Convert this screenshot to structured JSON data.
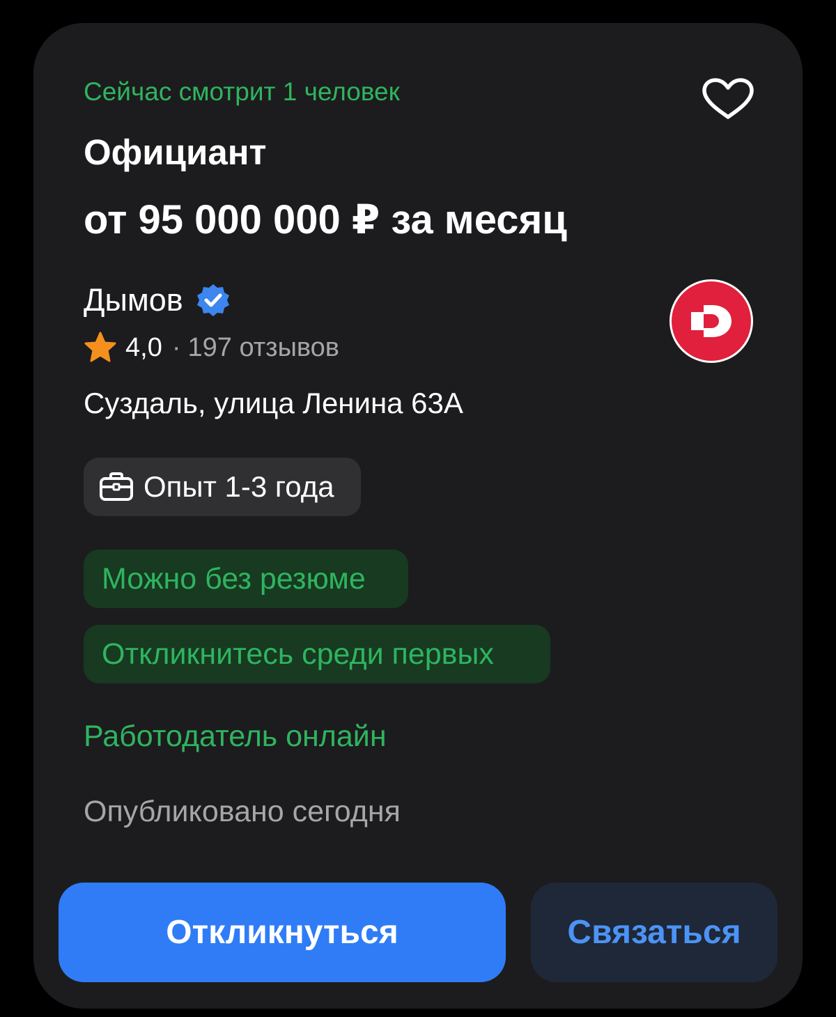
{
  "vacancy": {
    "viewers_text": "Сейчас смотрит 1 человек",
    "title": "Официант",
    "salary": "от 95 000 000 ₽ за месяц",
    "employer_name": "Дымов",
    "rating": "4,0",
    "separator": "·",
    "reviews": "197 отзывов",
    "address": "Суздаль, улица Ленина 63А",
    "experience": "Опыт 1-3 года",
    "tag_no_resume": "Можно без резюме",
    "tag_first": "Откликнитесь среди первых",
    "employer_online": "Работодатель онлайн",
    "published": "Опубликовано сегодня"
  },
  "buttons": {
    "respond": "Откликнуться",
    "contact": "Связаться"
  },
  "colors": {
    "background": "#000000",
    "card": "#1c1c1e",
    "accent_green": "#2fb45f",
    "primary_blue": "#2f7cf6",
    "secondary_button": "#1e2838",
    "secondary_text": "#4c93f5",
    "star": "#f5901e",
    "logo_red": "#e0203c"
  },
  "icons": {
    "favorite": "heart-outline-icon",
    "verified": "verified-badge-icon",
    "rating": "star-icon",
    "experience": "briefcase-icon",
    "logo": "employer-logo"
  }
}
